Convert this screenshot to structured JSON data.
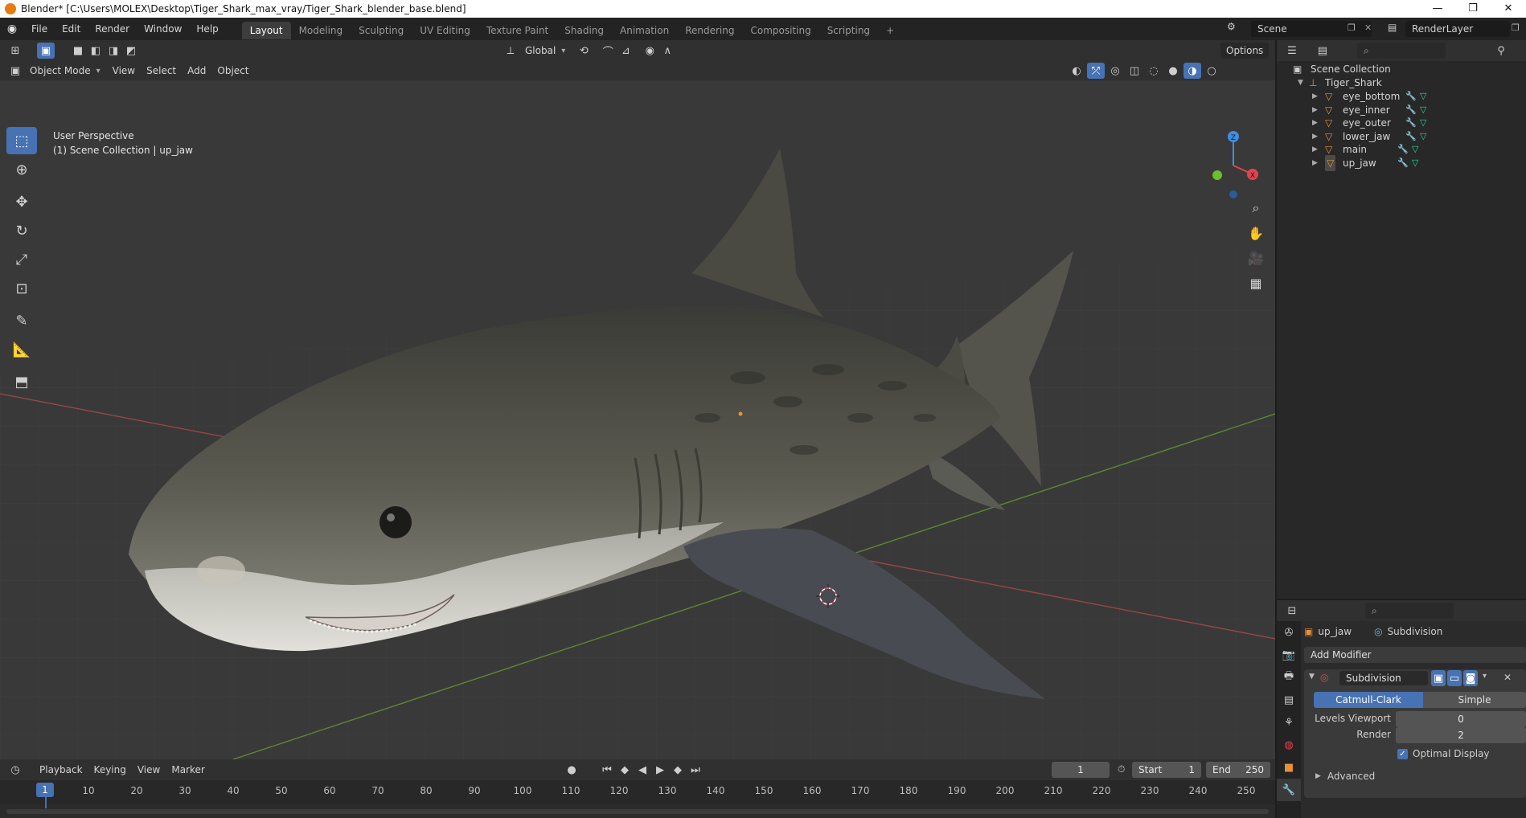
{
  "window": {
    "title": "Blender* [C:\\Users\\MOLEX\\Desktop\\Tiger_Shark_max_vray/Tiger_Shark_blender_base.blend]",
    "min": "—",
    "restore": "❐",
    "close": "✕"
  },
  "menu": {
    "items": [
      "File",
      "Edit",
      "Render",
      "Window",
      "Help"
    ]
  },
  "workspaces": {
    "tabs": [
      "Layout",
      "Modeling",
      "Sculpting",
      "UV Editing",
      "Texture Paint",
      "Shading",
      "Animation",
      "Rendering",
      "Compositing",
      "Scripting"
    ],
    "active": "Layout",
    "add": "+"
  },
  "scene": {
    "name": "Scene",
    "view_layer": "RenderLayer"
  },
  "viewport": {
    "transform_orientation": "Global",
    "options_label": "Options",
    "mode": "Object Mode",
    "menus": [
      "View",
      "Select",
      "Add",
      "Object"
    ],
    "info_line1": "User Perspective",
    "info_line2": "(1) Scene Collection | up_jaw",
    "gizmo": {
      "z": "Z",
      "x": "X"
    }
  },
  "timeline": {
    "menus": [
      "Playback",
      "Keying",
      "View",
      "Marker"
    ],
    "current_frame": "1",
    "start_label": "Start",
    "start": "1",
    "end_label": "End",
    "end": "250",
    "ticks": [
      "1",
      "10",
      "20",
      "30",
      "40",
      "50",
      "60",
      "70",
      "80",
      "90",
      "100",
      "110",
      "120",
      "130",
      "140",
      "150",
      "160",
      "170",
      "180",
      "190",
      "200",
      "210",
      "220",
      "230",
      "240",
      "250"
    ]
  },
  "outliner": {
    "root": "Scene Collection",
    "collection": "Tiger_Shark",
    "objects": [
      "eye_bottom",
      "eye_inner",
      "eye_outer",
      "lower_jaw",
      "main",
      "up_jaw"
    ]
  },
  "properties": {
    "object": "up_jaw",
    "modifier_crumb": "Subdivision",
    "add_modifier": "Add Modifier",
    "modifier": {
      "name": "Subdivision",
      "type_a": "Catmull-Clark",
      "type_b": "Simple",
      "levels_viewport_label": "Levels Viewport",
      "levels_viewport": "0",
      "render_label": "Render",
      "render": "2",
      "optimal_display_label": "Optimal Display",
      "advanced_label": "Advanced"
    }
  },
  "colors": {
    "accent": "#4772b3",
    "object_orange": "#e8913a",
    "x_axis": "#e2444e",
    "y_axis": "#6bbf2c",
    "z_axis": "#3e8fe0"
  }
}
